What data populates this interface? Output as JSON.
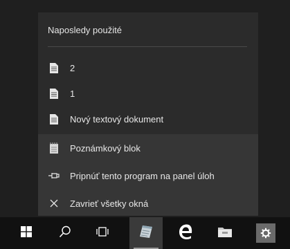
{
  "jumplist": {
    "header": "Naposledy použité",
    "recent": [
      {
        "label": "2",
        "icon": "document-icon"
      },
      {
        "label": "1",
        "icon": "document-icon"
      },
      {
        "label": "Nový textový dokument",
        "icon": "document-icon"
      }
    ],
    "tasks": [
      {
        "label": "Poznámkový blok",
        "icon": "notepad-icon"
      },
      {
        "label": "Pripnúť tento program na panel úloh",
        "icon": "pin-icon"
      },
      {
        "label": "Zavrieť všetky okná",
        "icon": "close-icon"
      }
    ]
  },
  "taskbar": {
    "items": [
      "start-icon",
      "search-icon",
      "task-view-icon",
      "notepad-icon",
      "edge-icon",
      "file-explorer-icon",
      "settings-icon"
    ]
  },
  "colors": {
    "jumplist_bg": "#2b2b2b",
    "tasks_bg": "#363636",
    "taskbar_bg": "#111111",
    "text": "#e8e8e8"
  }
}
